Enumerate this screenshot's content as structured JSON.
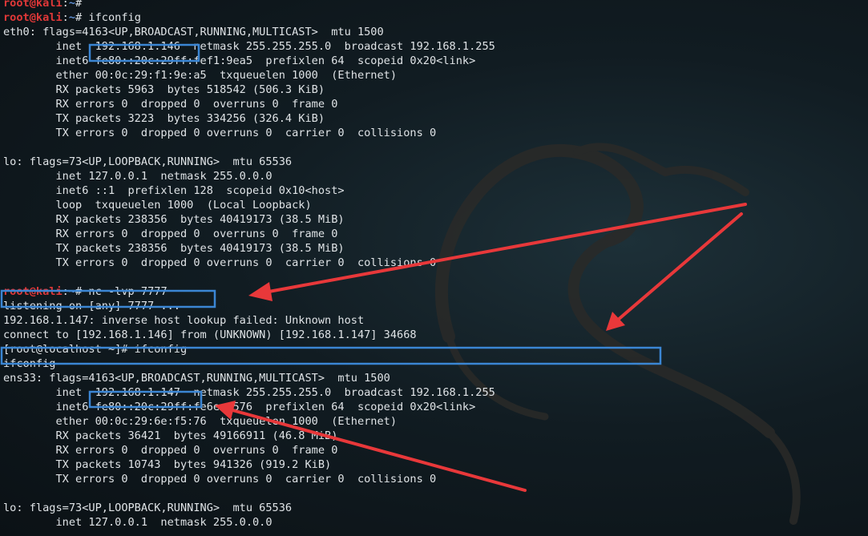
{
  "terminal": {
    "lines": [
      {
        "type": "prompt",
        "user": "root@kali",
        "sep": ":",
        "path": "~",
        "symbol": "# ",
        "cmd": ""
      },
      {
        "type": "prompt",
        "user": "root@kali",
        "sep": ":",
        "path": "~",
        "symbol": "# ",
        "cmd": "ifconfig"
      },
      {
        "type": "text",
        "text": "eth0: flags=4163<UP,BROADCAST,RUNNING,MULTICAST>  mtu 1500"
      },
      {
        "type": "text",
        "text": "        inet  192.168.1.146  netmask 255.255.255.0  broadcast 192.168.1.255"
      },
      {
        "type": "text",
        "text": "        inet6 fe80::20c:29ff:fef1:9ea5  prefixlen 64  scopeid 0x20<link>"
      },
      {
        "type": "text",
        "text": "        ether 00:0c:29:f1:9e:a5  txqueuelen 1000  (Ethernet)"
      },
      {
        "type": "text",
        "text": "        RX packets 5963  bytes 518542 (506.3 KiB)"
      },
      {
        "type": "text",
        "text": "        RX errors 0  dropped 0  overruns 0  frame 0"
      },
      {
        "type": "text",
        "text": "        TX packets 3223  bytes 334256 (326.4 KiB)"
      },
      {
        "type": "text",
        "text": "        TX errors 0  dropped 0 overruns 0  carrier 0  collisions 0"
      },
      {
        "type": "text",
        "text": ""
      },
      {
        "type": "text",
        "text": "lo: flags=73<UP,LOOPBACK,RUNNING>  mtu 65536"
      },
      {
        "type": "text",
        "text": "        inet 127.0.0.1  netmask 255.0.0.0"
      },
      {
        "type": "text",
        "text": "        inet6 ::1  prefixlen 128  scopeid 0x10<host>"
      },
      {
        "type": "text",
        "text": "        loop  txqueuelen 1000  (Local Loopback)"
      },
      {
        "type": "text",
        "text": "        RX packets 238356  bytes 40419173 (38.5 MiB)"
      },
      {
        "type": "text",
        "text": "        RX errors 0  dropped 0  overruns 0  frame 0"
      },
      {
        "type": "text",
        "text": "        TX packets 238356  bytes 40419173 (38.5 MiB)"
      },
      {
        "type": "text",
        "text": "        TX errors 0  dropped 0 overruns 0  carrier 0  collisions 0"
      },
      {
        "type": "text",
        "text": ""
      },
      {
        "type": "prompt",
        "user": "root@kali",
        "sep": ":",
        "path": "~",
        "symbol": "# ",
        "cmd": "nc -lvp 7777"
      },
      {
        "type": "text",
        "text": "listening on [any] 7777 ..."
      },
      {
        "type": "text",
        "text": "192.168.1.147: inverse host lookup failed: Unknown host"
      },
      {
        "type": "text",
        "text": "connect to [192.168.1.146] from (UNKNOWN) [192.168.1.147] 34668"
      },
      {
        "type": "text",
        "text": "[root@localhost ~]# ifconfig"
      },
      {
        "type": "text",
        "text": "ifconfig"
      },
      {
        "type": "text",
        "text": "ens33: flags=4163<UP,BROADCAST,RUNNING,MULTICAST>  mtu 1500"
      },
      {
        "type": "text",
        "text": "        inet  192.168.1.147  netmask 255.255.255.0  broadcast 192.168.1.255"
      },
      {
        "type": "text",
        "text": "        inet6 fe80::20c:29ff:fe6e:f576  prefixlen 64  scopeid 0x20<link>"
      },
      {
        "type": "text",
        "text": "        ether 00:0c:29:6e:f5:76  txqueuelen 1000  (Ethernet)"
      },
      {
        "type": "text",
        "text": "        RX packets 36421  bytes 49166911 (46.8 MiB)"
      },
      {
        "type": "text",
        "text": "        RX errors 0  dropped 0  overruns 0  frame 0"
      },
      {
        "type": "text",
        "text": "        TX packets 10743  bytes 941326 (919.2 KiB)"
      },
      {
        "type": "text",
        "text": "        TX errors 0  dropped 0 overruns 0  carrier 0  collisions 0"
      },
      {
        "type": "text",
        "text": ""
      },
      {
        "type": "text",
        "text": "lo: flags=73<UP,LOOPBACK,RUNNING>  mtu 65536"
      },
      {
        "type": "text",
        "text": "        inet 127.0.0.1  netmask 255.0.0.0"
      }
    ]
  },
  "annotations": {
    "highlight_color": "#3b86d4",
    "arrow_color": "#e8383a"
  },
  "colors": {
    "background": "#0d1419",
    "text": "#dfe3e6",
    "prompt_user": "#e03838",
    "prompt_path": "#5f8fd4"
  }
}
